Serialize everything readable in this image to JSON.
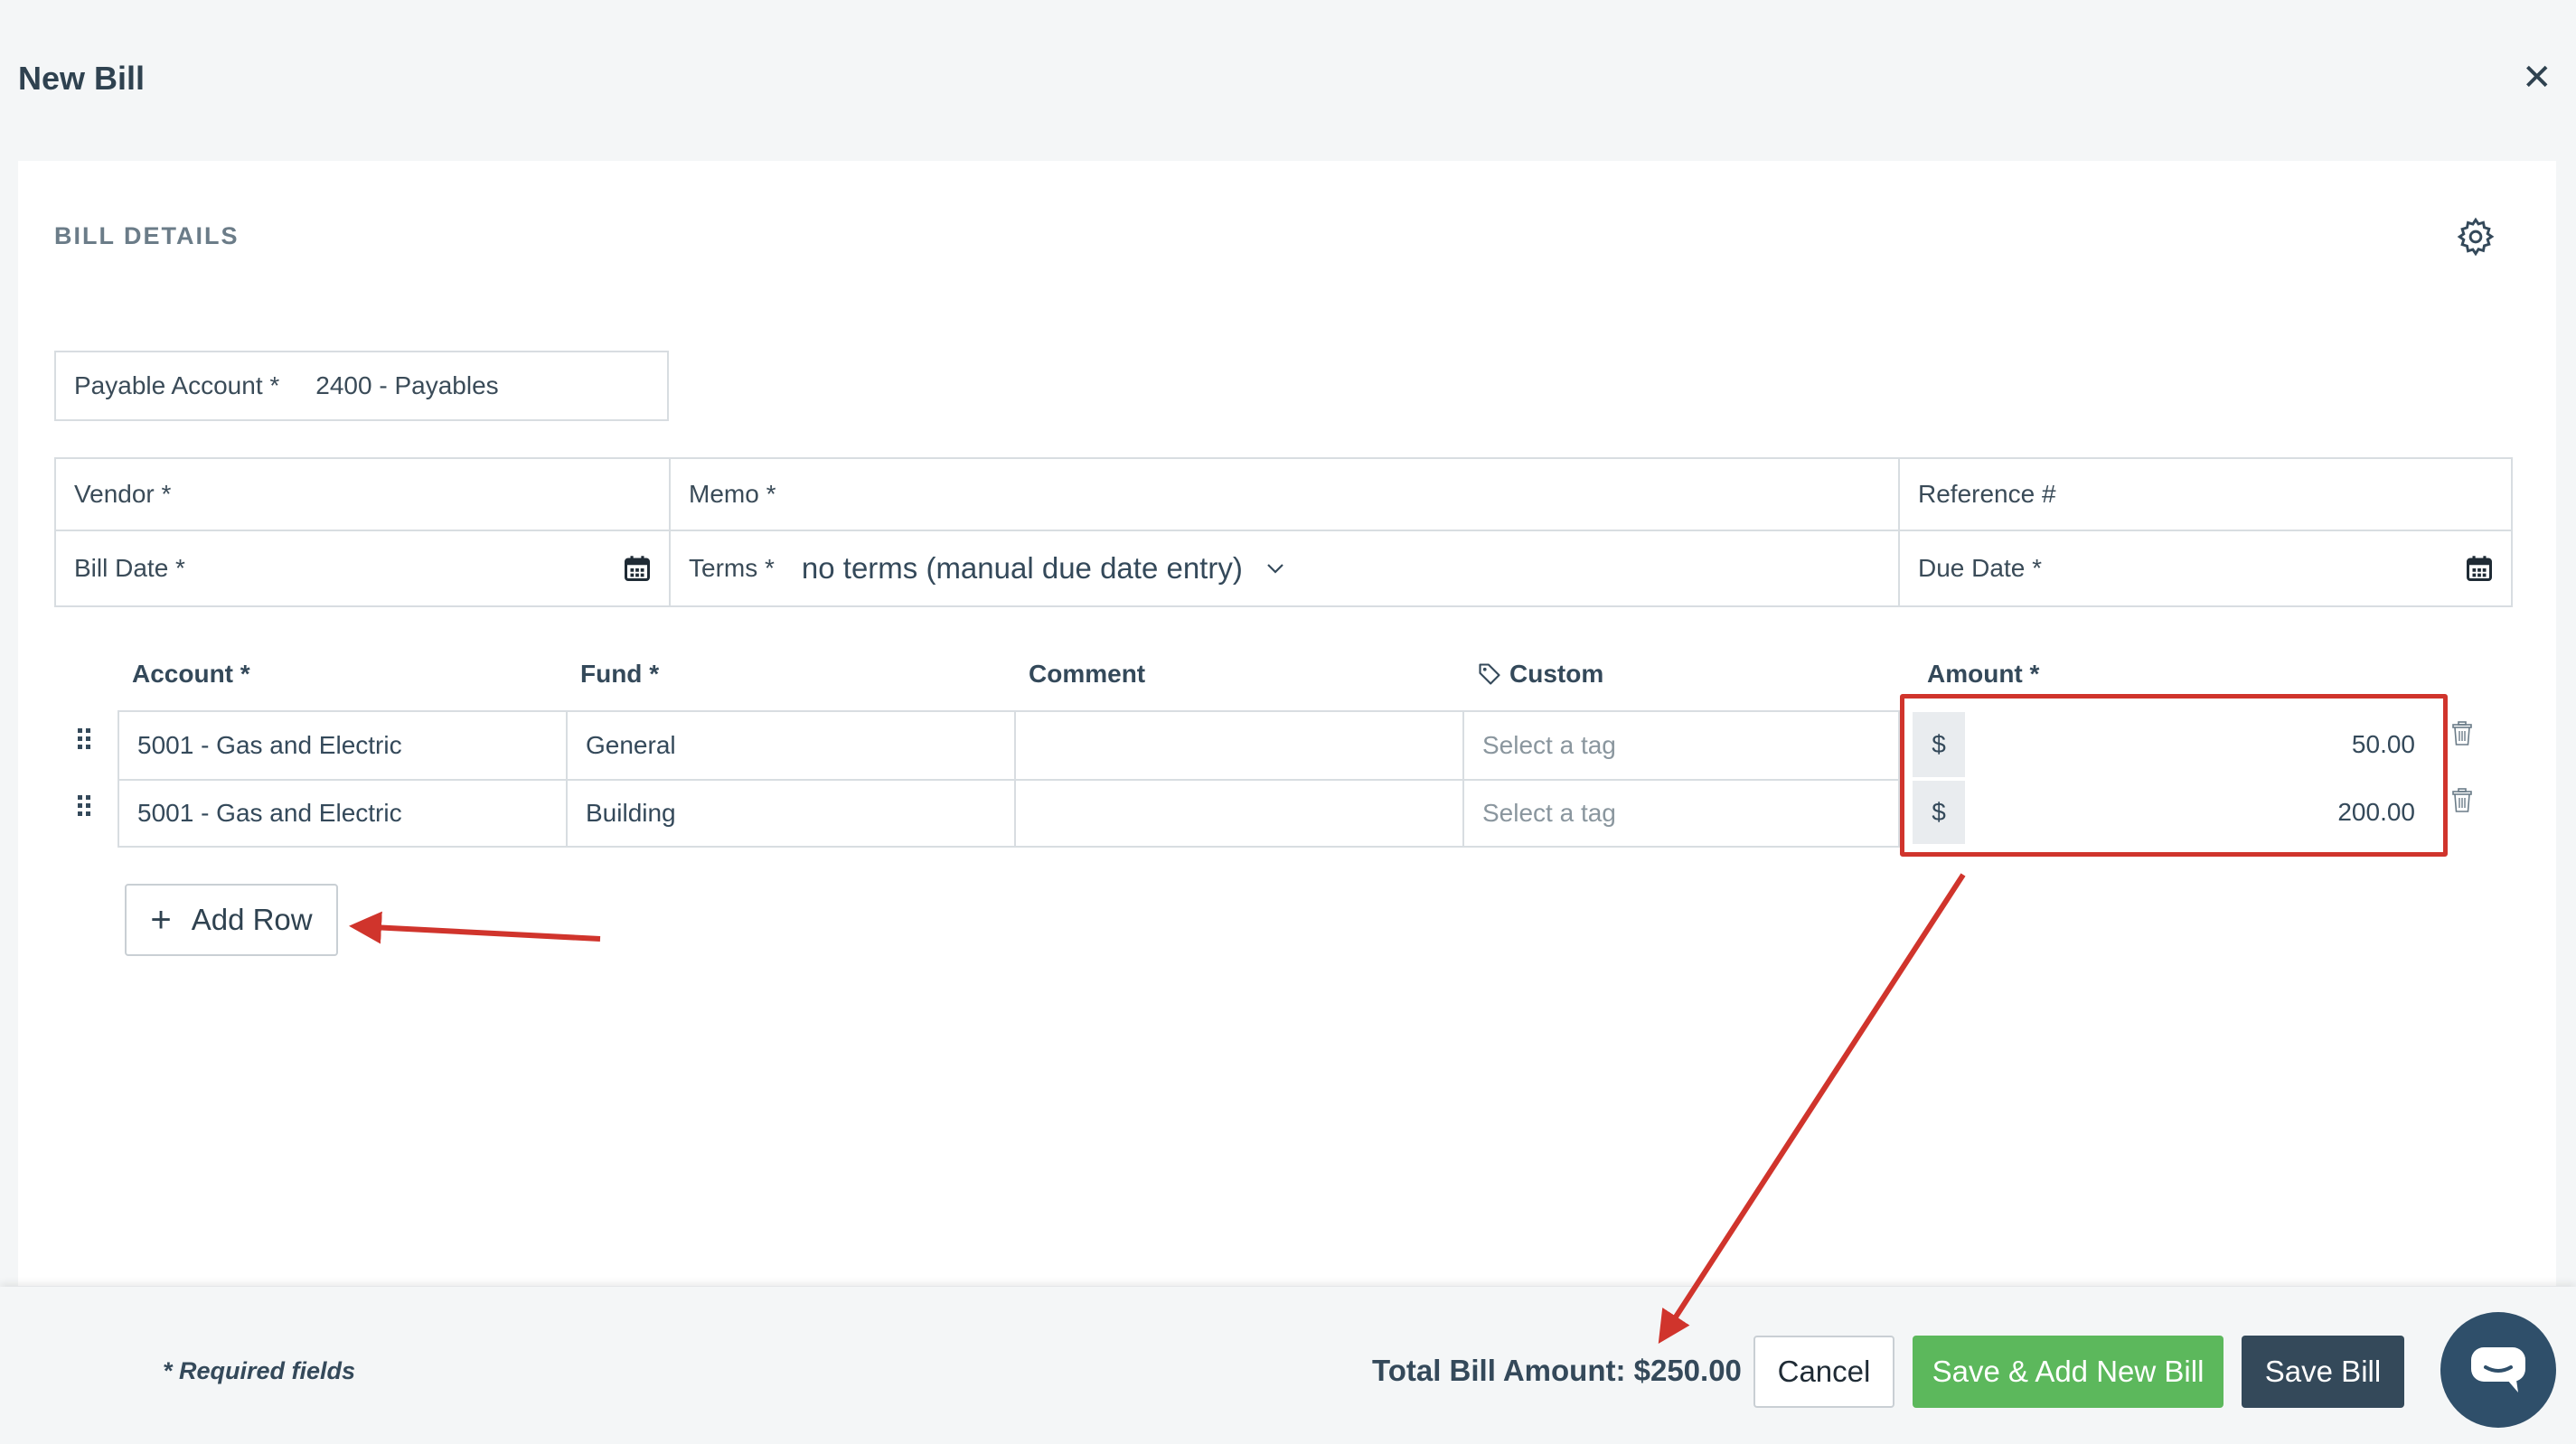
{
  "modal": {
    "title": "New Bill",
    "close_icon": "close-icon"
  },
  "section": {
    "title": "BILL DETAILS",
    "settings_icon": "gear-icon"
  },
  "payable_account": {
    "label": "Payable Account *",
    "value": "2400 - Payables"
  },
  "form": {
    "vendor": {
      "label": "Vendor *",
      "value": ""
    },
    "memo": {
      "label": "Memo *",
      "value": ""
    },
    "reference": {
      "label": "Reference #",
      "value": ""
    },
    "bill_date": {
      "label": "Bill Date *",
      "value": ""
    },
    "terms": {
      "label": "Terms *",
      "value": "no terms (manual due date entry)"
    },
    "due_date": {
      "label": "Due Date *",
      "value": ""
    }
  },
  "table": {
    "columns": [
      "Account *",
      "Fund *",
      "Comment",
      "Custom",
      "Amount *"
    ],
    "rows": [
      {
        "account": "5001 - Gas and Electric",
        "fund": "General",
        "comment": "",
        "custom_placeholder": "Select a tag",
        "currency": "$",
        "amount": "50.00"
      },
      {
        "account": "5001 - Gas and Electric",
        "fund": "Building",
        "comment": "",
        "custom_placeholder": "Select a tag",
        "currency": "$",
        "amount": "200.00"
      }
    ]
  },
  "add_row_button": {
    "label": "Add Row"
  },
  "footer": {
    "required_note": "* Required fields",
    "total": "Total Bill Amount: $250.00",
    "cancel": "Cancel",
    "save_add_new": "Save & Add New Bill",
    "save": "Save Bill"
  },
  "colors": {
    "accent_green": "#5cb85c",
    "dark_button": "#34495a",
    "annotation_red": "#d0342c"
  }
}
